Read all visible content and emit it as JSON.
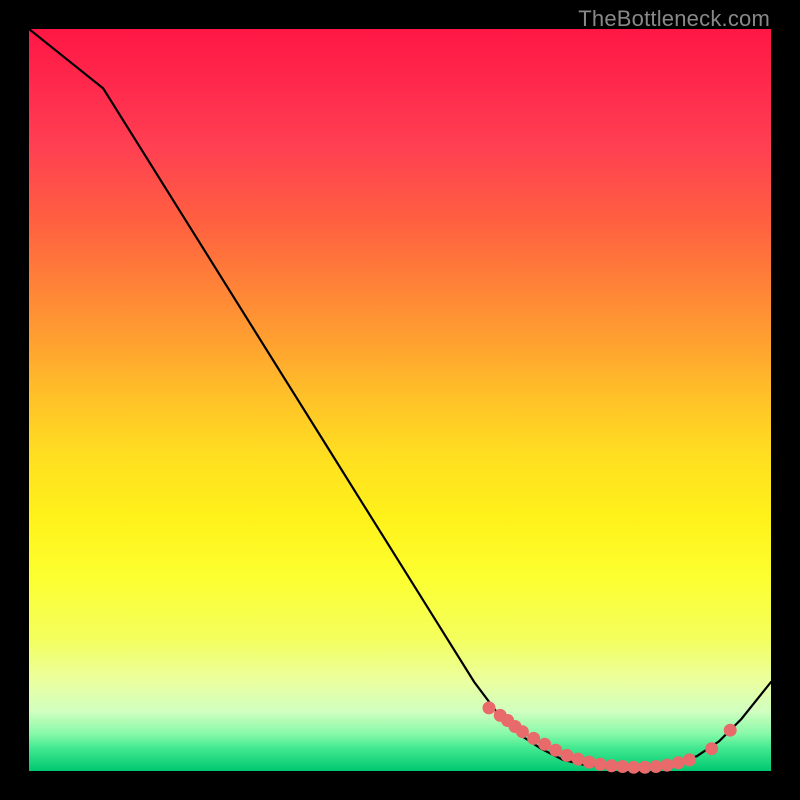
{
  "watermark": "TheBottleneck.com",
  "chart_data": {
    "type": "line",
    "title": "",
    "xlabel": "",
    "ylabel": "",
    "xlim": [
      0,
      100
    ],
    "ylim": [
      0,
      100
    ],
    "series": [
      {
        "name": "curve",
        "x": [
          0,
          5,
          10,
          15,
          20,
          25,
          30,
          35,
          40,
          45,
          50,
          55,
          60,
          63,
          66,
          69,
          72,
          75,
          78,
          81,
          84,
          87,
          90,
          93,
          96,
          100
        ],
        "y": [
          100,
          96,
          92,
          84,
          76,
          68,
          60,
          52,
          44,
          36,
          28,
          20,
          12,
          8,
          5,
          3,
          1.5,
          0.8,
          0.5,
          0.5,
          0.6,
          1.0,
          2.0,
          4.0,
          7.0,
          12
        ]
      }
    ],
    "highlight_points": {
      "name": "trough-markers",
      "color": "#e86a6a",
      "x": [
        62,
        63.5,
        64.5,
        65.5,
        66.5,
        68,
        69.5,
        71,
        72.5,
        74,
        75.5,
        77,
        78.5,
        80,
        81.5,
        83,
        84.5,
        86,
        87.5,
        89,
        92,
        94.5
      ],
      "y": [
        8.5,
        7.5,
        6.8,
        6.0,
        5.3,
        4.4,
        3.6,
        2.8,
        2.1,
        1.6,
        1.2,
        0.9,
        0.7,
        0.6,
        0.5,
        0.5,
        0.6,
        0.8,
        1.1,
        1.5,
        3.0,
        5.5
      ]
    }
  }
}
